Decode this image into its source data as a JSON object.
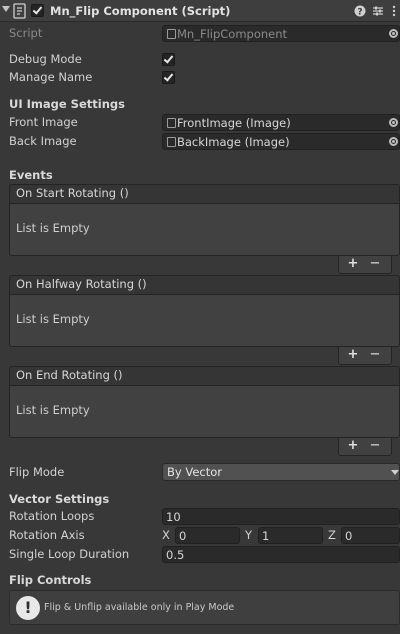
{
  "header": {
    "title": "Mn_Flip Component (Script)",
    "enabled": true,
    "icons": [
      "help-icon",
      "presets-icon",
      "more-icon"
    ]
  },
  "script": {
    "label": "Script",
    "value": "Mn_FlipComponent"
  },
  "debug_mode": {
    "label": "Debug Mode",
    "checked": true
  },
  "manage_name": {
    "label": "Manage Name",
    "checked": true
  },
  "ui_image_settings": {
    "heading": "UI Image Settings",
    "front": {
      "label": "Front Image",
      "value": "FrontImage (Image)"
    },
    "back": {
      "label": "Back Image",
      "value": "BackImage (Image)"
    }
  },
  "events": {
    "heading": "Events",
    "items": [
      {
        "title": "On Start Rotating ()",
        "empty_text": "List is Empty"
      },
      {
        "title": "On Halfway Rotating ()",
        "empty_text": "List is Empty"
      },
      {
        "title": "On End Rotating ()",
        "empty_text": "List is Empty"
      }
    ],
    "add_label": "+",
    "remove_label": "−"
  },
  "flip_mode": {
    "label": "Flip Mode",
    "value": "By Vector"
  },
  "vector_settings": {
    "heading": "Vector Settings",
    "rotation_loops": {
      "label": "Rotation Loops",
      "value": "10"
    },
    "rotation_axis": {
      "label": "Rotation Axis",
      "x_label": "X",
      "x": "0",
      "y_label": "Y",
      "y": "1",
      "z_label": "Z",
      "z": "0"
    },
    "single_loop_duration": {
      "label": "Single Loop Duration",
      "value": "0.5"
    }
  },
  "flip_controls": {
    "heading": "Flip Controls",
    "warning_symbol": "!",
    "message": "Flip & Unflip available only in Play Mode"
  }
}
